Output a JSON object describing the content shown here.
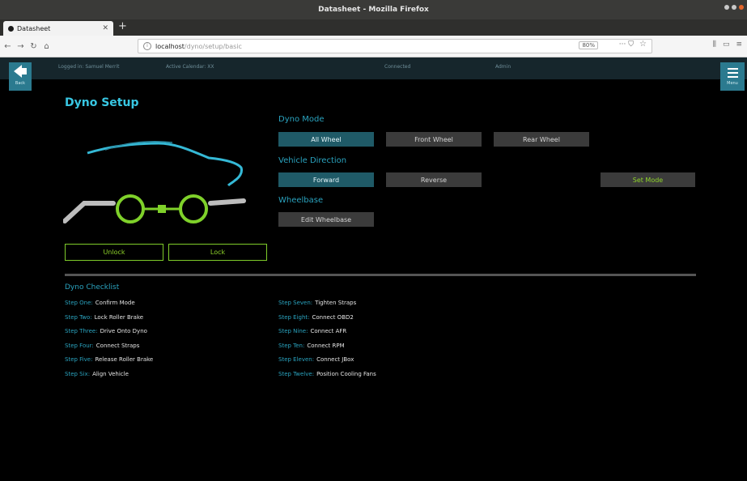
{
  "browser": {
    "window_title": "Datasheet - Mozilla Firefox",
    "tab_title": "Datasheet",
    "url_host": "localhost",
    "url_path": "/dyno/setup/basic",
    "zoom": "80%"
  },
  "header": {
    "back_label": "Back",
    "menu_label": "Menu",
    "logged_in": "Logged in: Samuel Merrit",
    "active_calendar": "Active Calendar: XX",
    "status": "Connected",
    "name": "Admin"
  },
  "page": {
    "title": "Dyno Setup"
  },
  "dyno_mode": {
    "label": "Dyno Mode",
    "options": [
      "All Wheel",
      "Front Wheel",
      "Rear Wheel"
    ],
    "selected": "All Wheel"
  },
  "vehicle_direction": {
    "label": "Vehicle Direction",
    "options": [
      "Forward",
      "Reverse"
    ],
    "selected": "Forward",
    "set_mode_label": "Set Mode"
  },
  "wheelbase": {
    "label": "Wheelbase",
    "edit_label": "Edit Wheelbase"
  },
  "lock_controls": {
    "unlock_label": "Unlock",
    "lock_label": "Lock"
  },
  "checklist": {
    "title": "Dyno Checklist",
    "left": [
      {
        "step": "Step One:",
        "task": "Confirm Mode"
      },
      {
        "step": "Step Two:",
        "task": "Lock Roller Brake"
      },
      {
        "step": "Step Three:",
        "task": "Drive Onto Dyno"
      },
      {
        "step": "Step Four:",
        "task": "Connect Straps"
      },
      {
        "step": "Step Five:",
        "task": "Release Roller Brake"
      },
      {
        "step": "Step Six:",
        "task": "Align Vehicle"
      }
    ],
    "right": [
      {
        "step": "Step Seven:",
        "task": "Tighten Straps"
      },
      {
        "step": "Step Eight:",
        "task": "Connect OBD2"
      },
      {
        "step": "Step Nine:",
        "task": "Connect AFR"
      },
      {
        "step": "Step Ten:",
        "task": "Connect RPM"
      },
      {
        "step": "Step Eleven:",
        "task": "Connect JBox"
      },
      {
        "step": "Step Twelve:",
        "task": "Position Cooling Fans"
      }
    ]
  },
  "colors": {
    "accent": "#38c7e3",
    "header_bg": "#16262c",
    "button_active": "#1f5a67",
    "button": "#3b3b3b",
    "green": "#8fd42a"
  }
}
